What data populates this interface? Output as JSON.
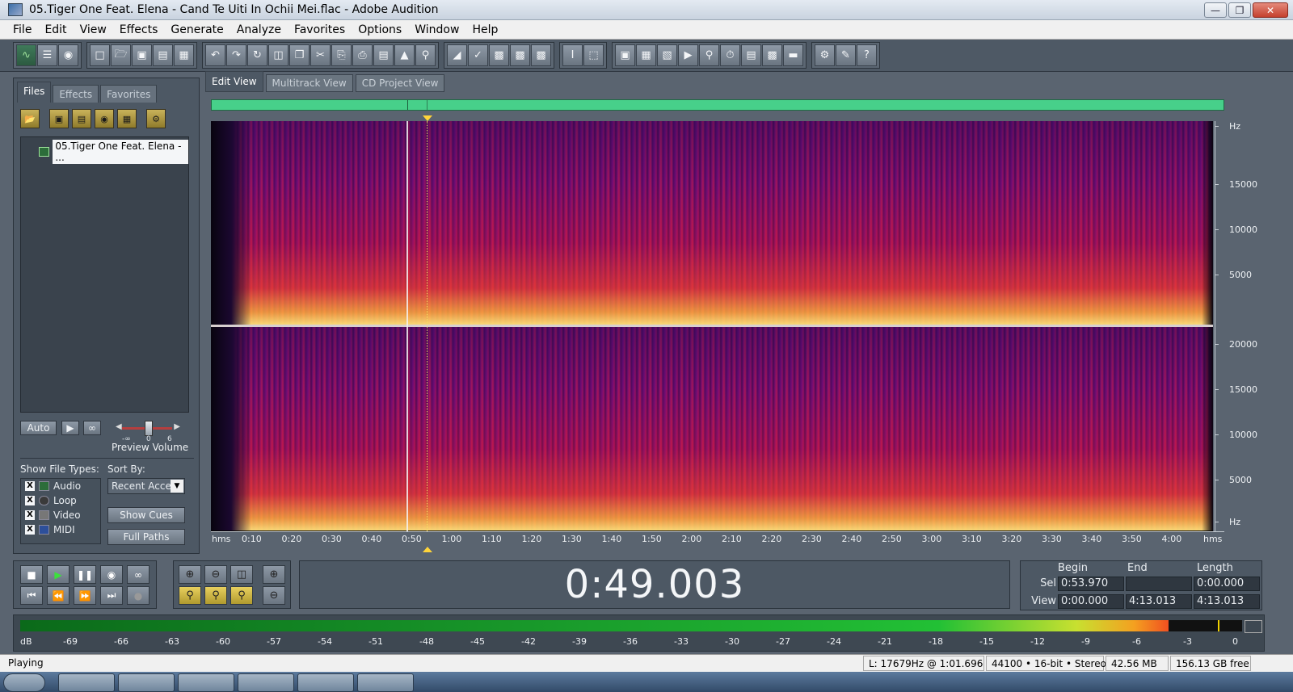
{
  "window": {
    "title": "05.Tiger One Feat. Elena - Cand Te Uiti In Ochii Mei.flac - Adobe Audition"
  },
  "menu": [
    "File",
    "Edit",
    "View",
    "Effects",
    "Generate",
    "Analyze",
    "Favorites",
    "Options",
    "Window",
    "Help"
  ],
  "left_panel": {
    "tabs": [
      "Files",
      "Effects",
      "Favorites"
    ],
    "file_name": "05.Tiger One Feat. Elena - ...",
    "auto_label": "Auto",
    "preview_volume_label": "Preview Volume",
    "volume_ticks": [
      "-∞",
      "0",
      "6"
    ],
    "show_types_label": "Show File Types:",
    "sort_by_label": "Sort By:",
    "sort_value": "Recent Acce",
    "types": [
      "Audio",
      "Loop",
      "Video",
      "MIDI"
    ],
    "show_cues_label": "Show Cues",
    "full_paths_label": "Full Paths"
  },
  "view_tabs": [
    "Edit View",
    "Multitrack View",
    "CD Project View"
  ],
  "freq_scale": {
    "left_channel": [
      "Hz",
      "15000",
      "10000",
      "5000"
    ],
    "right_channel": [
      "20000",
      "15000",
      "10000",
      "5000",
      "Hz"
    ]
  },
  "time_ruler": [
    "hms",
    "0:10",
    "0:20",
    "0:30",
    "0:40",
    "0:50",
    "1:00",
    "1:10",
    "1:20",
    "1:30",
    "1:40",
    "1:50",
    "2:00",
    "2:10",
    "2:20",
    "2:30",
    "2:40",
    "2:50",
    "3:00",
    "3:10",
    "3:20",
    "3:30",
    "3:40",
    "3:50",
    "4:00",
    "hms"
  ],
  "time_display": "0:49.003",
  "selection": {
    "headers": [
      "Begin",
      "End",
      "Length"
    ],
    "sel_label": "Sel",
    "view_label": "View",
    "sel_begin": "0:53.970",
    "sel_end": "",
    "sel_length": "0:00.000",
    "view_begin": "0:00.000",
    "view_end": "4:13.013",
    "view_length": "4:13.013"
  },
  "level_meter": {
    "scale": [
      "dB",
      "-69",
      "-66",
      "-63",
      "-60",
      "-57",
      "-54",
      "-51",
      "-48",
      "-45",
      "-42",
      "-39",
      "-36",
      "-33",
      "-30",
      "-27",
      "-24",
      "-21",
      "-18",
      "-15",
      "-12",
      "-9",
      "-6",
      "-3",
      "0"
    ],
    "level_fraction": 0.94,
    "peak_fraction": 0.98
  },
  "status": {
    "state": "Playing",
    "cursor_info": "L: 17679Hz @   1:01.696",
    "format": "44100 • 16-bit • Stereo",
    "size": "42.56 MB",
    "free": "156.13 GB free"
  },
  "colors": {
    "overview": "#47d08a",
    "cursor": "#ffd43a",
    "panel": "#4d5864"
  }
}
